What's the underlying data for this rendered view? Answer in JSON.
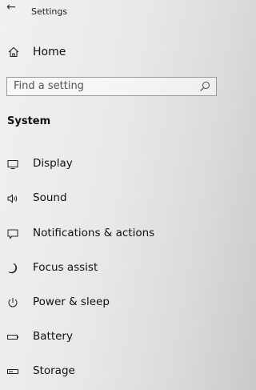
{
  "window": {
    "title": "Settings",
    "back_icon": "back-arrow-icon"
  },
  "nav": {
    "home": {
      "label": "Home",
      "icon": "home-icon"
    },
    "search": {
      "placeholder": "Find a setting",
      "icon": "search-icon"
    },
    "section_title": "System",
    "items": [
      {
        "label": "Display",
        "icon": "display-icon"
      },
      {
        "label": "Sound",
        "icon": "sound-icon"
      },
      {
        "label": "Notifications & actions",
        "icon": "notifications-icon"
      },
      {
        "label": "Focus assist",
        "icon": "focus-assist-icon"
      },
      {
        "label": "Power & sleep",
        "icon": "power-icon"
      },
      {
        "label": "Battery",
        "icon": "battery-icon"
      },
      {
        "label": "Storage",
        "icon": "storage-icon"
      }
    ]
  }
}
